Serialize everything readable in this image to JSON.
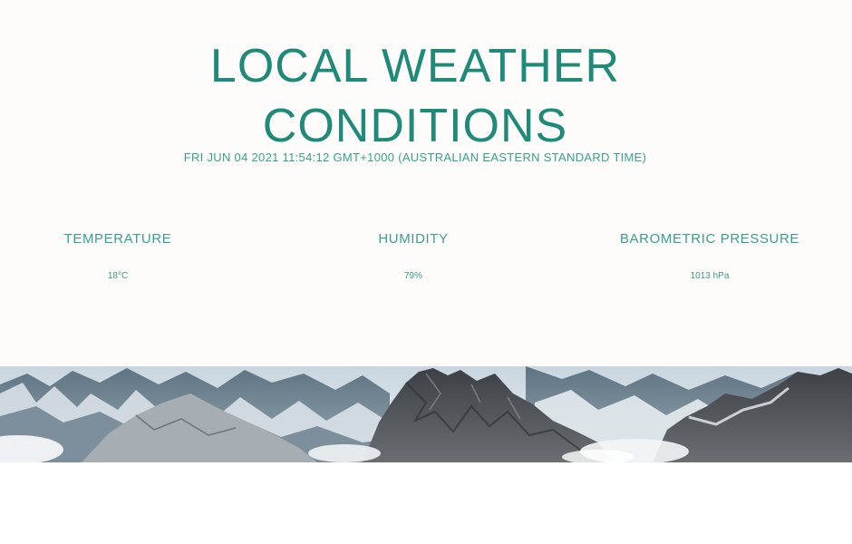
{
  "header": {
    "title_line1": "LOCAL WEATHER",
    "title_line2": "CONDITIONS",
    "timestamp": "FRI JUN 04 2021 11:54:12 GMT+1000 (AUSTRALIAN EASTERN STANDARD TIME)"
  },
  "metrics": {
    "temperature": {
      "label": "TEMPERATURE",
      "value": "18°C"
    },
    "humidity": {
      "label": "HUMIDITY",
      "value": "79%"
    },
    "pressure": {
      "label": "BAROMETRIC PRESSURE",
      "value": "1013 hPa"
    }
  },
  "colors": {
    "accent": "#1f8a78",
    "background": "#fdfcfb"
  }
}
